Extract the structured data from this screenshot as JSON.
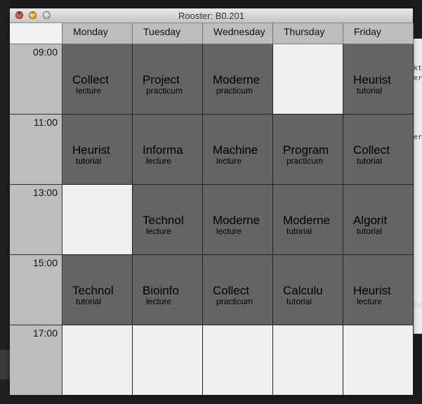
{
  "window": {
    "title": "Rooster: B0.201"
  },
  "days": [
    "Monday",
    "Tuesday",
    "Wednesday",
    "Thursday",
    "Friday"
  ],
  "times": [
    "09:00",
    "11:00",
    "13:00",
    "15:00",
    "17:00"
  ],
  "rows": [
    [
      {
        "course": "Collect",
        "kind": "lecture"
      },
      {
        "course": "Project",
        "kind": "practicum"
      },
      {
        "course": "Moderne",
        "kind": "practicum"
      },
      null,
      {
        "course": "Heurist",
        "kind": "tutorial"
      }
    ],
    [
      {
        "course": "Heurist",
        "kind": "tutorial"
      },
      {
        "course": "Informa",
        "kind": "lecture"
      },
      {
        "course": "Machine",
        "kind": "lecture"
      },
      {
        "course": "Program",
        "kind": "practicum"
      },
      {
        "course": "Collect",
        "kind": "tutorial"
      }
    ],
    [
      null,
      {
        "course": "Technol",
        "kind": "lecture"
      },
      {
        "course": "Moderne",
        "kind": "lecture"
      },
      {
        "course": "Moderne",
        "kind": "tutorial"
      },
      {
        "course": "Algorit",
        "kind": "tutorial"
      }
    ],
    [
      {
        "course": "Technol",
        "kind": "tutorial"
      },
      {
        "course": "Bioinfo",
        "kind": "lecture"
      },
      {
        "course": "Collect",
        "kind": "practicum"
      },
      {
        "course": "Calculu",
        "kind": "tutorial"
      },
      {
        "course": "Heurist",
        "kind": "lecture"
      }
    ],
    [
      null,
      null,
      null,
      null,
      null
    ]
  ],
  "background": {
    "right_panel_lines": [
      "kt",
      "er",
      "er"
    ],
    "right_label": "Re"
  },
  "colors": {
    "filled": "#646464",
    "empty": "#f0f0f0",
    "header": "#bdbdbd"
  }
}
